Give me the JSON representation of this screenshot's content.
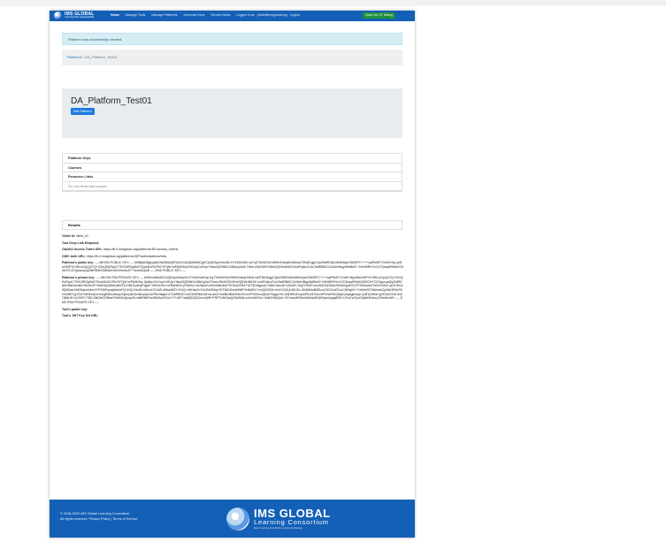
{
  "brand": {
    "name": "IMS GLOBAL",
    "sub": "Learning Tools Interoperability"
  },
  "nav": {
    "links": [
      "Home",
      "Manage Tools",
      "Manage Platforms",
      "Generate Keys",
      "Review Notes"
    ],
    "user": [
      "Logged in as",
      "j.fiallo@imsglobal.org",
      "Logout"
    ],
    "lti_button": "Open DA LTI Testing"
  },
  "alert": "Platform was successfully created.",
  "breadcrumb": {
    "root": "Platforms",
    "separator": "/",
    "current": "DA_Platform_Test01"
  },
  "platform": {
    "title": "DA_Platform_Test01",
    "edit_label": "Edit Platform"
  },
  "sections": [
    "Platform Keys",
    "Courses",
    "Resource Links"
  ],
  "resource_links_hint": "For Line Items view courses",
  "results_label": "Results",
  "details": {
    "client_id_label": "Client Id:",
    "client_id": "client_01",
    "deep_link_label": "Tool Deep Link Endpoint:",
    "token_url_label": "OAuth2 Access Token URL:",
    "token_url": "https://lti-ri.imsglobal.org/platforms/387/access_tokens",
    "oidc_label": "OIDC Auth URL:",
    "oidc_url": "https://lti-ri.imsglobal.org/platforms/387/authorizations/new",
    "public_key_label": "Platform's public key:",
    "public_key": "-----BEGIN PUBLIC KEY----- MIIBIjANBgkqhkiG9w0BAQEFAAOCAQ8AMIIBCgKCAQEAyhXbrpNLX7rXkfXvMD cp+iqTXfoWOh2nRMVKlobqNGkMsd4TBdJKggCQaOlWBTolk1lM0b5yaCW6SPC++++xqlPM4FYO/eiD+8p yh8wXMPYkY8Krc2JpQzTQ+OZxQEsFbpK77EK2tRGg9kKT3/yfsN1fSCPkIYIFQM+wPj9IK9hyG9OwyCnSVyrY9sw9QEW6Gv3Bk1y0dxk TNmLI/9k2KRiC9Nh0QEWvBrfXDIrxbPvjfzuZVsC5afRlt80CZmDeHBqyMWBdS+ 2r5rWlRHYvCd7QhapR9Wb2G0lGHYCZOgnvuaQq2NlRDdKDMkDdvhlhXrSmIn2F+ ibwDAQAB -----END PUBLIC KEY-----",
    "private_key_label": "Platform's private key:",
    "private_key": "-----BEGIN RSA PRIVATE KEY----- MIIEowIBAAKCAQEAyhXbrpNLX7rXkfXvMDcp+iqTXfoWOh2nRMVKlobqNGkM sd4TBdJKggCQaOlWBTolk1lM0b5yaCW6SPC++++xqlPM4FYO/eiD+8pyh8wXMPYkY8Krc2JpQzTQ+OZxQEsFbpK77EK2tRGg9kKT3/yfsN1fSCPkIYIFQM+wPj9IK9hy Qo8ksYKOwyCnSVyrY9sw9QEW6Gv3Bk1y0dxTNmLI/9k2KRiC9Nh0QEWvBrfXD IrxbPvjfzuZVsC5afRlt80CZmDeHBqyMWBdS+2r5rWlRHYvCd7QhapR9Wb2G0lGHYCZOgnvuaQq2NlRDdKDMkDdvhlhXrSmIn2F+ibwDAQABAoIBAFjCOBU1p4eqPqgNT MIDUX0o+oRMebEd+yFWrIhu+kU6qKkVdVbXkt6x8n/TSO5u22054TUtT3Drttgsd/y GNbhYavcW+QKoRt J3sjYGK4PUmv5UD0Z0z6c/9hhMngctr37pTFHh5wAe7H/ILhS3GZ gGIO6r1vlSj9lGaeGkf0Saeuh/lraVIYPO9fRpwq5laHzFQ1HQUVb4Ev/eEuoDCXdB u5bvrNED+DXQ+rWHzkZvYGuSWG5epTKTBAY6dvIWMEYeNWDCYm/QD0SZs+kVKXQ5 jKDE/Ec J6N6MmBtS5cuCNGCsrEEccCfKNyNY+XrK6e05TWkmdsCpWsi3R4bP5Hrs39ECgYEA7hhDhmpVrrCbgBDecWuqn4Jjnvy/kKl4nBvqUqx/Iv/R6vh6gb4 k7OkRBDD7oxS1NR9bnnM+aLanUYmbBk3BdHENoTrmvXPHi3xu4QkW7NqgUrJ6 ckN/9f81ExqxbPEu0HCkvmPVhbRSvZjNjcQnqbgkkxqx/ yxBTpWbsCgYEAx2G/M 5o0OliMUH+cGIXRY70DC4NSfxOORaelYWH0IsQuzpSh+a8iR6WYwI8MGaGNJoY P+itJF+kd6j5DQ0Zovrn/j9R+P9PTUNGbaQ/Nb5N4k1vb/Xe8VNL+3dkDHMQkUr r97vwAzflO0mkMeNuM2dIRyw/l4pxgfBS0 LlYwYwTpnEfqWeRzbm1OHsWvhtFr -----END RSA PRIVATE KEY-----",
    "tool_public_key_label": "Tool's public key:",
    "tool_jwks_label": "Tool's JWT Key Set URL:"
  },
  "footer": {
    "copyright": "© 2018-2020 IMS Global Learning Consortium.",
    "rights": "All rights reserved.",
    "privacy": "Privacy Policy",
    "terms": "Terms of Service",
    "logo_name": "IMS GLOBAL",
    "logo_sub": "Learning Consortium",
    "logo_tag": "Better Learning From Better Learning Technology"
  },
  "colors": {
    "primary": "#1460b7",
    "alert_bg": "#d7edf5",
    "lti_button": "#1e8f3c",
    "edit_button": "#1f7ae0"
  }
}
